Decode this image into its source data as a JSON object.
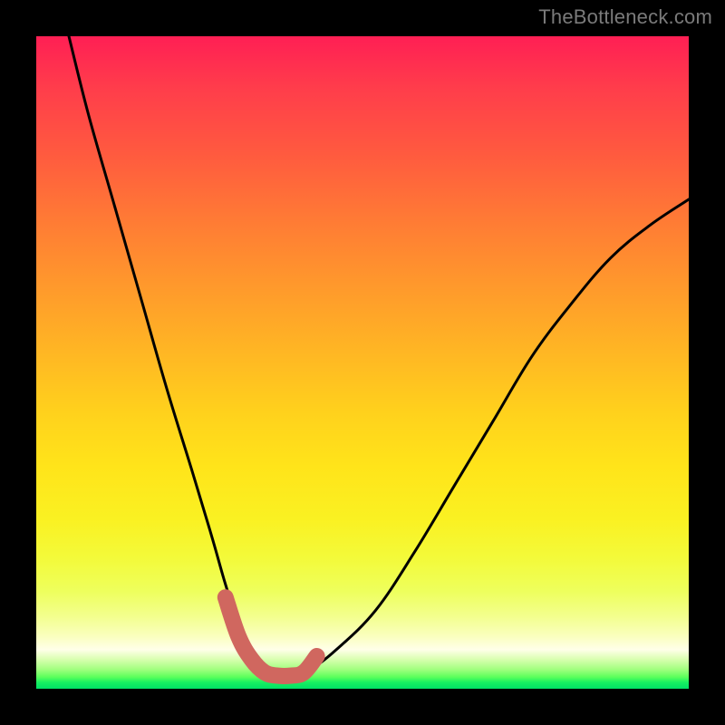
{
  "watermark": "TheBottleneck.com",
  "chart_data": {
    "type": "line",
    "title": "",
    "xlabel": "",
    "ylabel": "",
    "xlim": [
      0,
      100
    ],
    "ylim": [
      0,
      100
    ],
    "grid": false,
    "legend": false,
    "background_gradient": {
      "direction": "vertical",
      "stops": [
        {
          "pos": 0,
          "color": "#ff1f54"
        },
        {
          "pos": 50,
          "color": "#ffd21c"
        },
        {
          "pos": 92,
          "color": "#ffffe9"
        },
        {
          "pos": 100,
          "color": "#00e066"
        }
      ]
    },
    "series": [
      {
        "name": "bottleneck-curve",
        "color": "#000000",
        "x": [
          5,
          8,
          12,
          16,
          20,
          24,
          27,
          29,
          31,
          33,
          35,
          37,
          39,
          42,
          46,
          52,
          58,
          64,
          70,
          76,
          82,
          88,
          94,
          100
        ],
        "y": [
          100,
          88,
          74,
          60,
          46,
          33,
          23,
          16,
          10,
          6,
          3,
          2,
          2,
          3,
          6,
          12,
          21,
          31,
          41,
          51,
          59,
          66,
          71,
          75
        ]
      }
    ],
    "highlight": {
      "name": "optimal-zone",
      "color": "#d0675f",
      "x": [
        29,
        31,
        33,
        35,
        37,
        39,
        41,
        43
      ],
      "y": [
        14,
        8,
        4.5,
        2.5,
        2,
        2,
        2.5,
        5
      ]
    }
  }
}
